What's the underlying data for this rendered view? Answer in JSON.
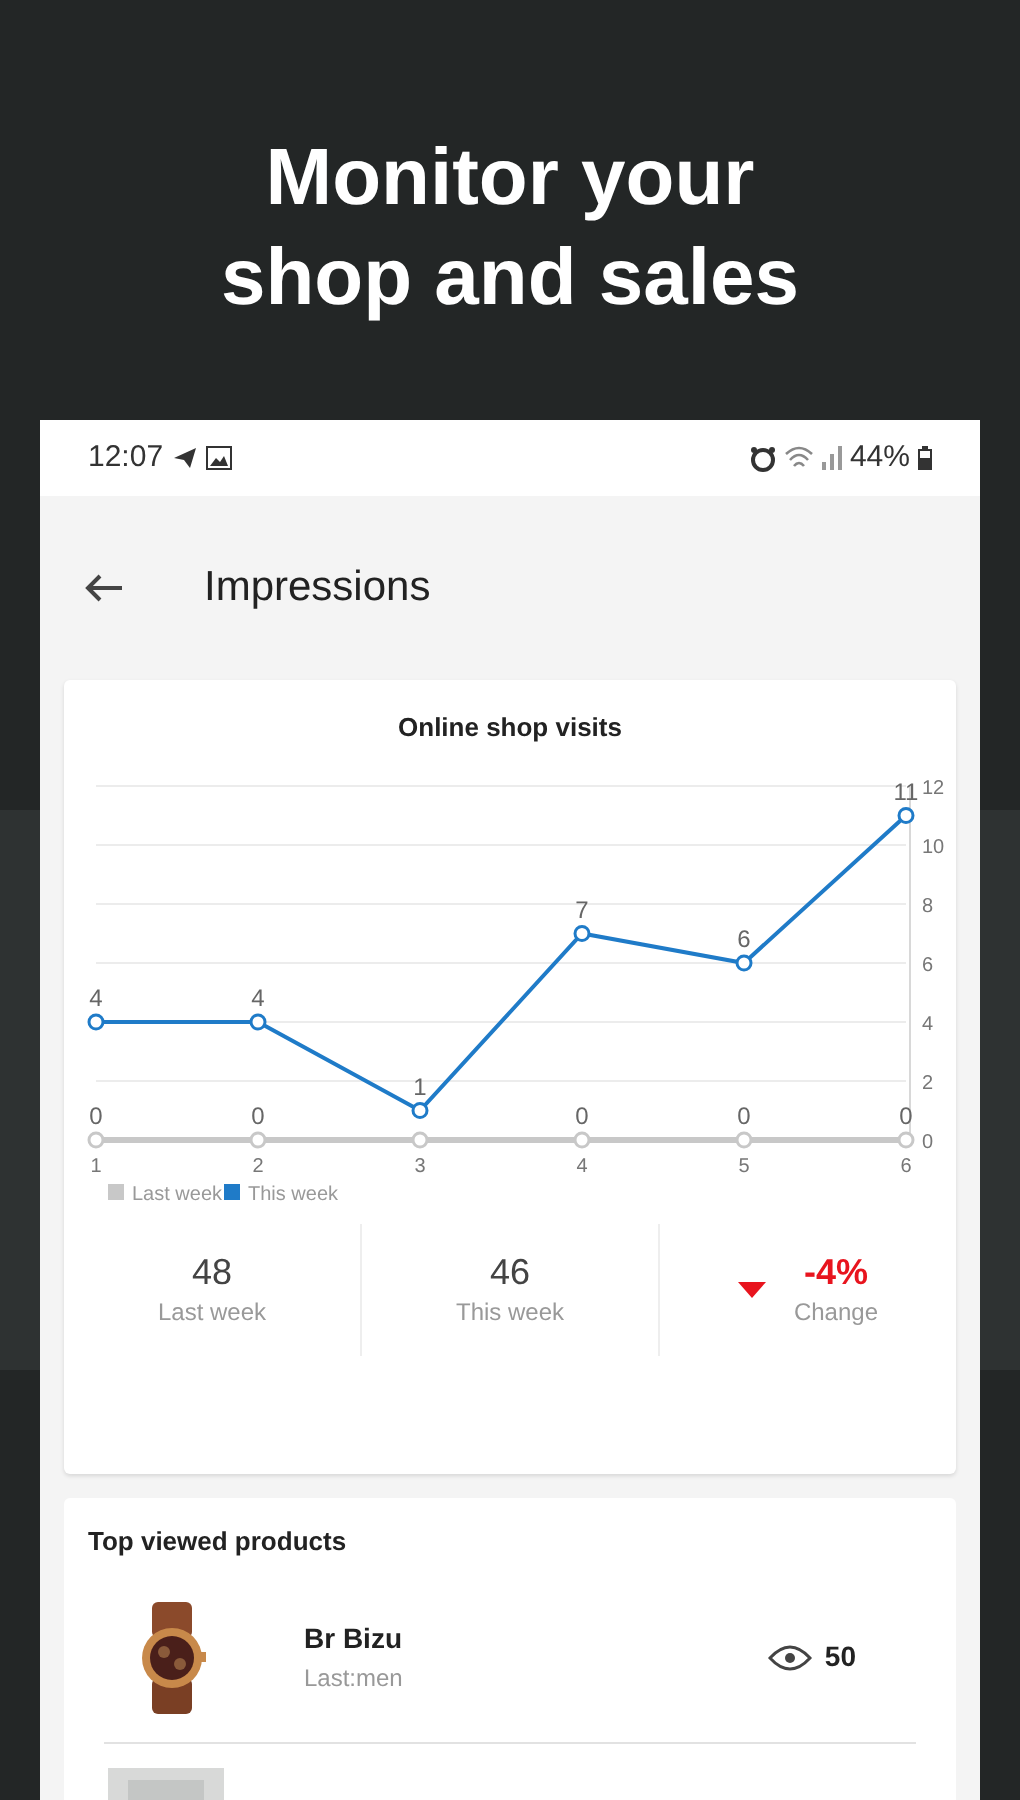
{
  "headline": "Monitor your shop and sales",
  "status_bar": {
    "time": "12:07",
    "battery": "44%"
  },
  "app_bar": {
    "title": "Impressions"
  },
  "visits_card": {
    "title": "Online shop visits",
    "chart_data": {
      "type": "line",
      "grid": true,
      "legend": true,
      "categories": [
        "1",
        "2",
        "3",
        "4",
        "5",
        "6"
      ],
      "ylim": [
        0,
        12
      ],
      "yticks": [
        0,
        2,
        4,
        6,
        8,
        10,
        12
      ],
      "value_labels": [
        [
          "0",
          "0",
          null,
          "0",
          "0",
          "0"
        ],
        [
          "4",
          "4",
          "1",
          "7",
          "6",
          "11"
        ]
      ],
      "series": [
        {
          "name": "Last week",
          "color": "#c8c8c8",
          "marker": "circle",
          "values": [
            0,
            0,
            0,
            0,
            0,
            0
          ]
        },
        {
          "name": "This week",
          "color": "#1f7bc8",
          "marker": "circle",
          "values": [
            4,
            4,
            1,
            7,
            6,
            11
          ]
        }
      ]
    },
    "stats": [
      {
        "kind": "plain",
        "value": "48",
        "label": "Last week"
      },
      {
        "kind": "plain",
        "value": "46",
        "label": "This week"
      },
      {
        "kind": "down",
        "value": "-4%",
        "label": "Change"
      }
    ]
  },
  "top_products": {
    "title": "Top viewed products",
    "items": [
      {
        "kind": "product",
        "name": "Br Bizu",
        "subtitle": "Last:men",
        "views": "50"
      },
      {
        "kind": "picture"
      }
    ]
  }
}
